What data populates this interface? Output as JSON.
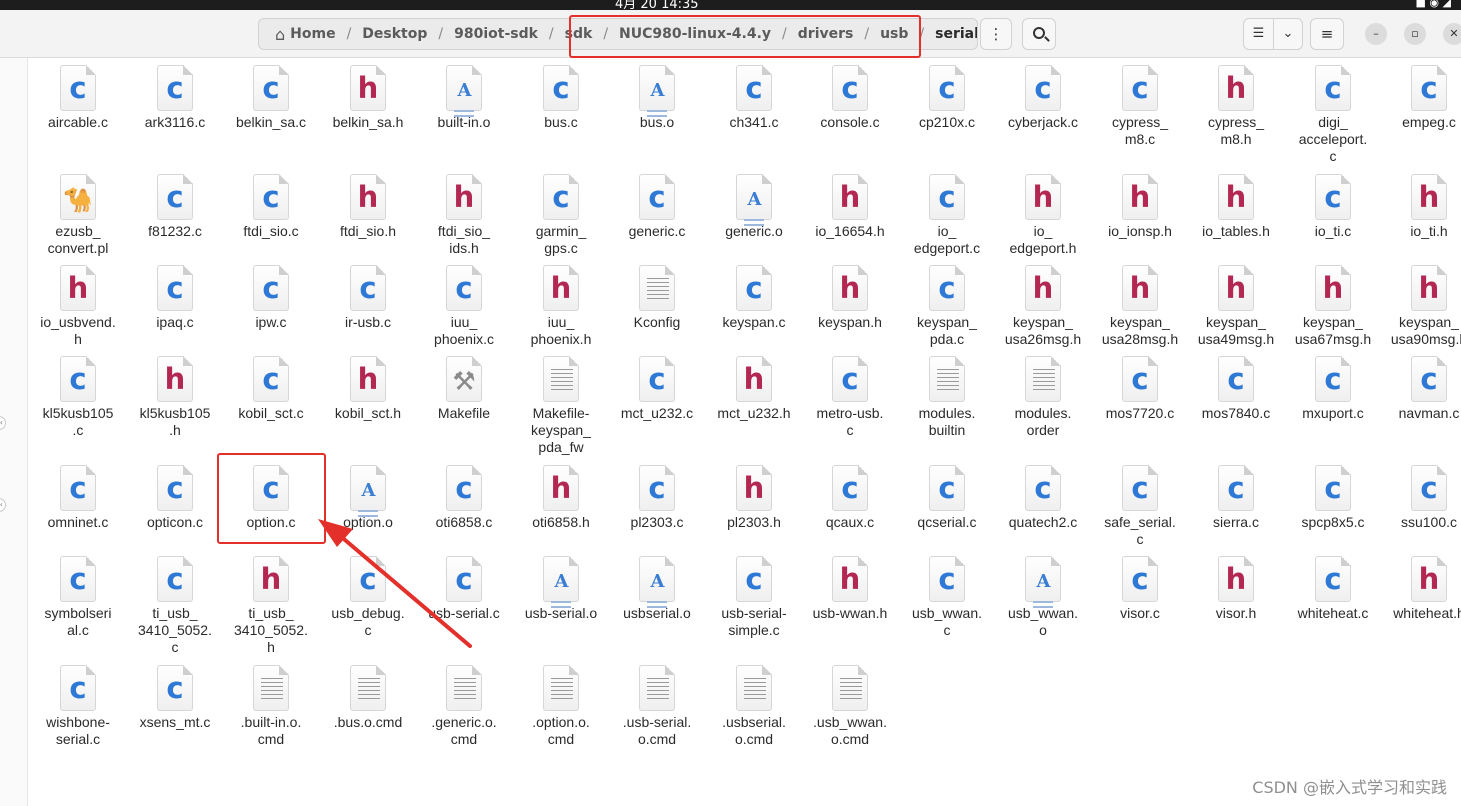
{
  "system_bar": {
    "clock": "4月 20 14:35",
    "tray": "■ ◉ ◢"
  },
  "header": {
    "home_icon": "home-icon",
    "breadcrumbs": [
      "Home",
      "Desktop",
      "980iot-sdk",
      "sdk",
      "NUC980-linux-4.4.y",
      "drivers",
      "usb",
      "serial"
    ],
    "separator": "/",
    "path_menu": "⋮",
    "view_list": "☰",
    "view_toggle": "⌄",
    "main_menu": "≡",
    "win_minimize": "–",
    "win_maximize": "▫",
    "win_close": "✕"
  },
  "left_nubs": [
    "‹",
    "‹"
  ],
  "files": [
    {
      "name": "aircable.c",
      "type": "c"
    },
    {
      "name": "ark3116.c",
      "type": "c"
    },
    {
      "name": "belkin_sa.c",
      "type": "c"
    },
    {
      "name": "belkin_sa.h",
      "type": "h"
    },
    {
      "name": "built-in.o",
      "type": "obj"
    },
    {
      "name": "bus.c",
      "type": "c"
    },
    {
      "name": "bus.o",
      "type": "obj"
    },
    {
      "name": "ch341.c",
      "type": "c"
    },
    {
      "name": "console.c",
      "type": "c"
    },
    {
      "name": "cp210x.c",
      "type": "c"
    },
    {
      "name": "cyberjack.c",
      "type": "c"
    },
    {
      "name": "cypress_\nm8.c",
      "type": "c"
    },
    {
      "name": "cypress_\nm8.h",
      "type": "h"
    },
    {
      "name": "digi_\nacceleport.\nc",
      "type": "c"
    },
    {
      "name": "empeg.c",
      "type": "c"
    },
    {
      "name": "ezusb_\nconvert.pl",
      "type": "pl"
    },
    {
      "name": "f81232.c",
      "type": "c"
    },
    {
      "name": "ftdi_sio.c",
      "type": "c"
    },
    {
      "name": "ftdi_sio.h",
      "type": "h"
    },
    {
      "name": "ftdi_sio_\nids.h",
      "type": "h"
    },
    {
      "name": "garmin_\ngps.c",
      "type": "c"
    },
    {
      "name": "generic.c",
      "type": "c"
    },
    {
      "name": "generic.o",
      "type": "obj"
    },
    {
      "name": "io_16654.h",
      "type": "h"
    },
    {
      "name": "io_\nedgeport.c",
      "type": "c"
    },
    {
      "name": "io_\nedgeport.h",
      "type": "h"
    },
    {
      "name": "io_ionsp.h",
      "type": "h"
    },
    {
      "name": "io_tables.h",
      "type": "h"
    },
    {
      "name": "io_ti.c",
      "type": "c"
    },
    {
      "name": "io_ti.h",
      "type": "h"
    },
    {
      "name": "io_usbvend.\nh",
      "type": "h"
    },
    {
      "name": "ipaq.c",
      "type": "c"
    },
    {
      "name": "ipw.c",
      "type": "c"
    },
    {
      "name": "ir-usb.c",
      "type": "c"
    },
    {
      "name": "iuu_\nphoenix.c",
      "type": "c"
    },
    {
      "name": "iuu_\nphoenix.h",
      "type": "h"
    },
    {
      "name": "Kconfig",
      "type": "txt"
    },
    {
      "name": "keyspan.c",
      "type": "c"
    },
    {
      "name": "keyspan.h",
      "type": "h"
    },
    {
      "name": "keyspan_\npda.c",
      "type": "c"
    },
    {
      "name": "keyspan_\nusa26msg.h",
      "type": "h"
    },
    {
      "name": "keyspan_\nusa28msg.h",
      "type": "h"
    },
    {
      "name": "keyspan_\nusa49msg.h",
      "type": "h"
    },
    {
      "name": "keyspan_\nusa67msg.h",
      "type": "h"
    },
    {
      "name": "keyspan_\nusa90msg.h",
      "type": "h"
    },
    {
      "name": "kl5kusb105\n.c",
      "type": "c"
    },
    {
      "name": "kl5kusb105\n.h",
      "type": "h"
    },
    {
      "name": "kobil_sct.c",
      "type": "c"
    },
    {
      "name": "kobil_sct.h",
      "type": "h"
    },
    {
      "name": "Makefile",
      "type": "mk"
    },
    {
      "name": "Makefile-\nkeyspan_\npda_fw",
      "type": "txt"
    },
    {
      "name": "mct_u232.c",
      "type": "c"
    },
    {
      "name": "mct_u232.h",
      "type": "h"
    },
    {
      "name": "metro-usb.\nc",
      "type": "c"
    },
    {
      "name": "modules.\nbuiltin",
      "type": "txt"
    },
    {
      "name": "modules.\norder",
      "type": "txt"
    },
    {
      "name": "mos7720.c",
      "type": "c"
    },
    {
      "name": "mos7840.c",
      "type": "c"
    },
    {
      "name": "mxuport.c",
      "type": "c"
    },
    {
      "name": "navman.c",
      "type": "c"
    },
    {
      "name": "omninet.c",
      "type": "c"
    },
    {
      "name": "opticon.c",
      "type": "c"
    },
    {
      "name": "option.c",
      "type": "c"
    },
    {
      "name": "option.o",
      "type": "obj"
    },
    {
      "name": "oti6858.c",
      "type": "c"
    },
    {
      "name": "oti6858.h",
      "type": "h"
    },
    {
      "name": "pl2303.c",
      "type": "c"
    },
    {
      "name": "pl2303.h",
      "type": "h"
    },
    {
      "name": "qcaux.c",
      "type": "c"
    },
    {
      "name": "qcserial.c",
      "type": "c"
    },
    {
      "name": "quatech2.c",
      "type": "c"
    },
    {
      "name": "safe_serial.\nc",
      "type": "c"
    },
    {
      "name": "sierra.c",
      "type": "c"
    },
    {
      "name": "spcp8x5.c",
      "type": "c"
    },
    {
      "name": "ssu100.c",
      "type": "c"
    },
    {
      "name": "symbolseri\nal.c",
      "type": "c"
    },
    {
      "name": "ti_usb_\n3410_5052.\nc",
      "type": "c"
    },
    {
      "name": "ti_usb_\n3410_5052.\nh",
      "type": "h"
    },
    {
      "name": "usb_debug.\nc",
      "type": "c"
    },
    {
      "name": "usb-serial.c",
      "type": "c"
    },
    {
      "name": "usb-serial.o",
      "type": "obj"
    },
    {
      "name": "usbserial.o",
      "type": "obj"
    },
    {
      "name": "usb-serial-\nsimple.c",
      "type": "c"
    },
    {
      "name": "usb-wwan.h",
      "type": "h"
    },
    {
      "name": "usb_wwan.\nc",
      "type": "c"
    },
    {
      "name": "usb_wwan.\no",
      "type": "obj"
    },
    {
      "name": "visor.c",
      "type": "c"
    },
    {
      "name": "visor.h",
      "type": "h"
    },
    {
      "name": "whiteheat.c",
      "type": "c"
    },
    {
      "name": "whiteheat.h",
      "type": "h"
    },
    {
      "name": "wishbone-\nserial.c",
      "type": "c"
    },
    {
      "name": "xsens_mt.c",
      "type": "c"
    },
    {
      "name": ".built-in.o.\ncmd",
      "type": "txt"
    },
    {
      "name": ".bus.o.cmd",
      "type": "txt"
    },
    {
      "name": ".generic.o.\ncmd",
      "type": "txt"
    },
    {
      "name": ".option.o.\ncmd",
      "type": "txt"
    },
    {
      "name": ".usb-serial.\no.cmd",
      "type": "txt"
    },
    {
      "name": ".usbserial.\no.cmd",
      "type": "txt"
    },
    {
      "name": ".usb_wwan.\no.cmd",
      "type": "txt"
    }
  ],
  "glyphs": {
    "c": "c",
    "h": "h",
    "obj": "A",
    "txt": "",
    "mk": "⚒",
    "pl": "🐪"
  },
  "icon_names": {
    "c": "c-source-file-icon",
    "h": "c-header-file-icon",
    "obj": "object-file-icon",
    "txt": "text-file-icon",
    "mk": "makefile-icon",
    "pl": "perl-script-icon"
  },
  "annotation_color": "#e3302a",
  "highlighted_file": "option.c",
  "watermark": "CSDN @嵌入式学习和实践"
}
